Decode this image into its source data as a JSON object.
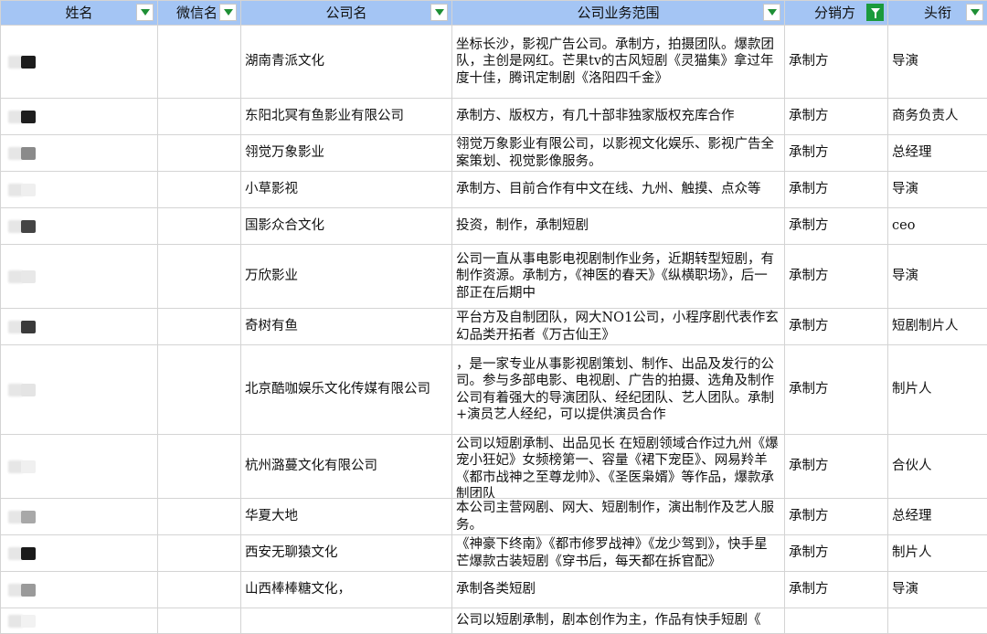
{
  "headers": [
    {
      "label": "姓名",
      "filter": "dropdown"
    },
    {
      "label": "微信名",
      "filter": "dropdown"
    },
    {
      "label": "公司名",
      "filter": "dropdown"
    },
    {
      "label": "公司业务范围",
      "filter": "dropdown"
    },
    {
      "label": "分销方",
      "filter": "active"
    },
    {
      "label": "头衔",
      "filter": "dropdown"
    }
  ],
  "rows": [
    {
      "company": "湖南青派文化",
      "scope": "坐标长沙，影视广告公司。承制方，拍摄团队。爆款团队，主创是网红。芒果tv的古风短剧《灵猫集》拿过年度十佳，腾讯定制剧《洛阳四千金》",
      "distributor": "承制方",
      "title": "导演",
      "blur": "#1c1c1c"
    },
    {
      "company": "东阳北冥有鱼影业有限公司",
      "scope": "承制方、版权方，有几十部非独家版权充库合作",
      "distributor": "承制方",
      "title": "商务负责人",
      "blur": "#1e1e1e"
    },
    {
      "company": "翎觉万象影业",
      "scope": "翎觉万象影业有限公司，以影视文化娱乐、影视广告全案策划、视觉影像服务。",
      "distributor": "承制方",
      "title": "总经理",
      "blur": "#8a8a8a"
    },
    {
      "company": "小草影视",
      "scope": "承制方、目前合作有中文在线、九州、触摸、点众等",
      "distributor": "承制方",
      "title": "导演",
      "blur": "#efefef"
    },
    {
      "company": "国影众合文化",
      "scope": "投资，制作，承制短剧",
      "distributor": "承制方",
      "title": "ceo",
      "blur": "#444444"
    },
    {
      "company": "万欣影业",
      "scope": "公司一直从事电影电视剧制作业务，近期转型短剧，有制作资源。承制方，《神医的春天》《纵横职场》，后一部正在后期中",
      "distributor": "承制方",
      "title": "导演",
      "blur": "#e8e8e8"
    },
    {
      "company": "奇树有鱼",
      "scope": "平台方及自制团队，网大NO1公司，小程序剧代表作玄幻品类开拓者《万古仙王》",
      "distributor": "承制方",
      "title": "短剧制片人",
      "blur": "#3a3a3a"
    },
    {
      "company": "北京酷咖娱乐文化传媒有限公司",
      "scope": "，是一家专业从事影视剧策划、制作、出品及发行的公司。参与多部电影、电视剧、广告的拍摄、选角及制作公司有着强大的导演团队、经纪团队、艺人团队。承制+演员艺人经纪，可以提供演员合作",
      "distributor": "承制方",
      "title": "制片人",
      "blur": "#e4e4e4"
    },
    {
      "company": "杭州潞蔓文化有限公司",
      "scope": "公司以短剧承制、出品见长 在短剧领域合作过九州《爆宠小狂妃》女频榜第一、容量《裙下宠臣》、网易羚羊《都市战神之至尊龙帅》、《圣医枭婿》等作品，爆款承制团队",
      "distributor": "承制方",
      "title": "合伙人",
      "blur": "#f0f0f0"
    },
    {
      "company": "华夏大地",
      "scope": "本公司主营网剧、网大、短剧制作，演出制作及艺人服务。",
      "distributor": "承制方",
      "title": "总经理",
      "blur": "#a8a8a8"
    },
    {
      "company": "西安无聊猿文化",
      "scope": "《神豪下终南》《都市修罗战神》《龙少驾到》，快手星芒爆款古装短剧《穿书后，每天都在拆官配》",
      "distributor": "承制方",
      "title": "制片人",
      "blur": "#1a1a1a"
    },
    {
      "company": "山西棒棒糖文化，",
      "scope": "承制各类短剧",
      "distributor": "承制方",
      "title": "导演",
      "blur": "#9a9a9a"
    },
    {
      "company": "",
      "scope": "公司以短剧承制，剧本创作为主，作品有快手短剧《",
      "distributor": "",
      "title": "",
      "blur": "#f2f2f2"
    }
  ]
}
